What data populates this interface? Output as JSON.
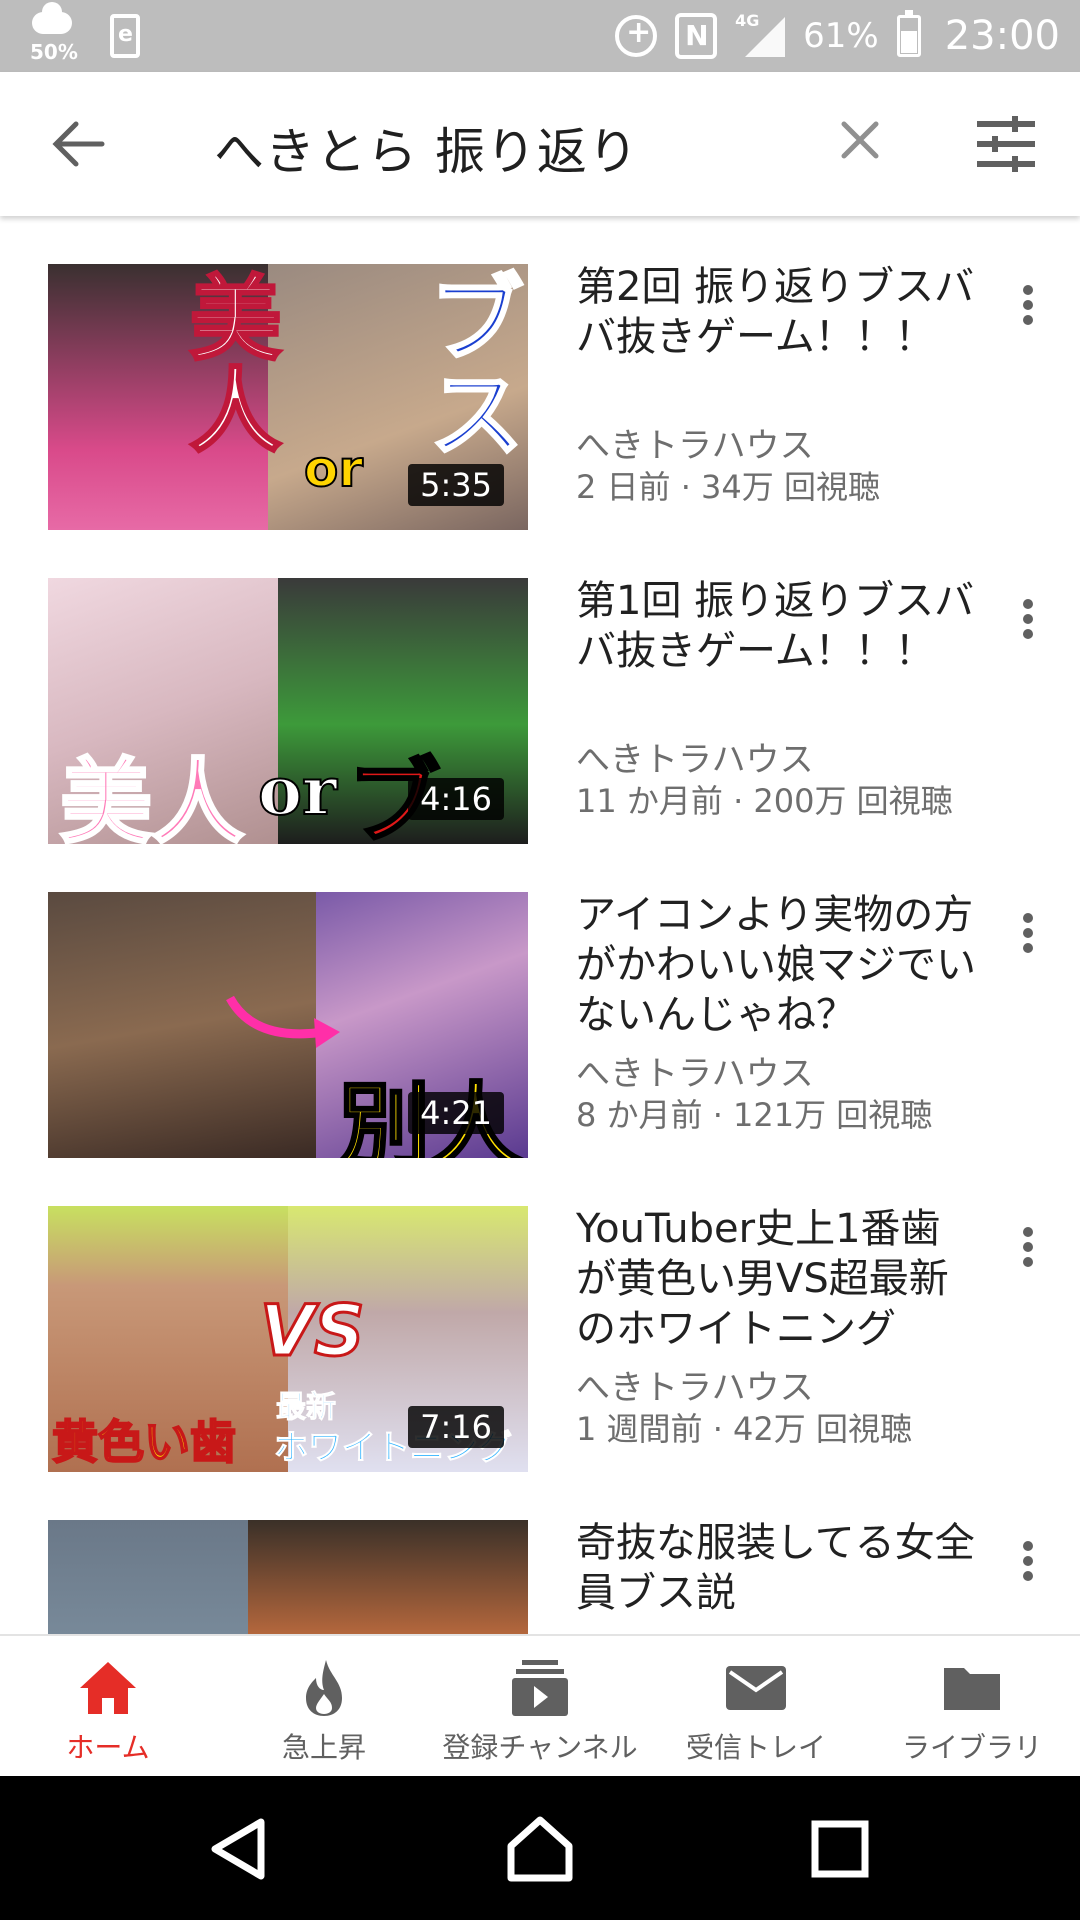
{
  "status_bar": {
    "weather_pct": "50%",
    "network_label": "4G",
    "battery_pct": "61%",
    "battery_level": 0.61,
    "time": "23:00",
    "icons": [
      "weather-cloud-icon",
      "sd-card-icon",
      "data-saver-icon",
      "nfc-icon",
      "signal-icon",
      "battery-icon"
    ]
  },
  "search": {
    "query": "へきとら 振り返り",
    "icons": [
      "back-arrow-icon",
      "clear-icon",
      "filter-icon"
    ]
  },
  "videos": [
    {
      "title": "第2回 振り返りブスババ抜きゲーム！！！",
      "channel": "へきトラハウス",
      "meta": "2 日前 · 34万 回視聴",
      "duration": "5:35",
      "thumb_texts": [
        "美人",
        "ブス",
        "or"
      ]
    },
    {
      "title": "第1回 振り返りブスババ抜きゲーム！！！",
      "channel": "へきトラハウス",
      "meta": "11 か月前 · 200万 回視聴",
      "duration": "4:16",
      "thumb_texts": [
        "美人",
        "or",
        "ブス"
      ]
    },
    {
      "title": "アイコンより実物の方がかわいい娘マジでいないんじゃね？",
      "channel": "へきトラハウス",
      "meta": "8 か月前 · 121万 回視聴",
      "duration": "4:21",
      "thumb_texts": [
        "別人"
      ]
    },
    {
      "title": "YouTuber史上1番歯が黄色い男VS超最新のホワイトニング",
      "channel": "へきトラハウス",
      "meta": "1 週間前 · 42万 回視聴",
      "duration": "7:16",
      "thumb_texts": [
        "VS",
        "黄色い歯",
        "最新",
        "ホワイトニング"
      ]
    },
    {
      "title": "奇抜な服装してる女全員ブス説",
      "channel": "",
      "meta": "",
      "duration": "",
      "thumb_texts": []
    }
  ],
  "bottom_nav": [
    {
      "label": "ホーム",
      "icon": "home-icon",
      "active": true
    },
    {
      "label": "急上昇",
      "icon": "flame-icon",
      "active": false
    },
    {
      "label": "登録チャンネル",
      "icon": "subscriptions-icon",
      "active": false
    },
    {
      "label": "受信トレイ",
      "icon": "inbox-icon",
      "active": false
    },
    {
      "label": "ライブラリ",
      "icon": "library-icon",
      "active": false
    }
  ],
  "system_nav": [
    "back-triangle-icon",
    "home-circle-icon",
    "recents-square-icon"
  ],
  "colors": {
    "accent": "#e52d27",
    "status_bar": "#bdbdbd",
    "text_primary": "#212121",
    "text_secondary": "#6e6e6e"
  }
}
